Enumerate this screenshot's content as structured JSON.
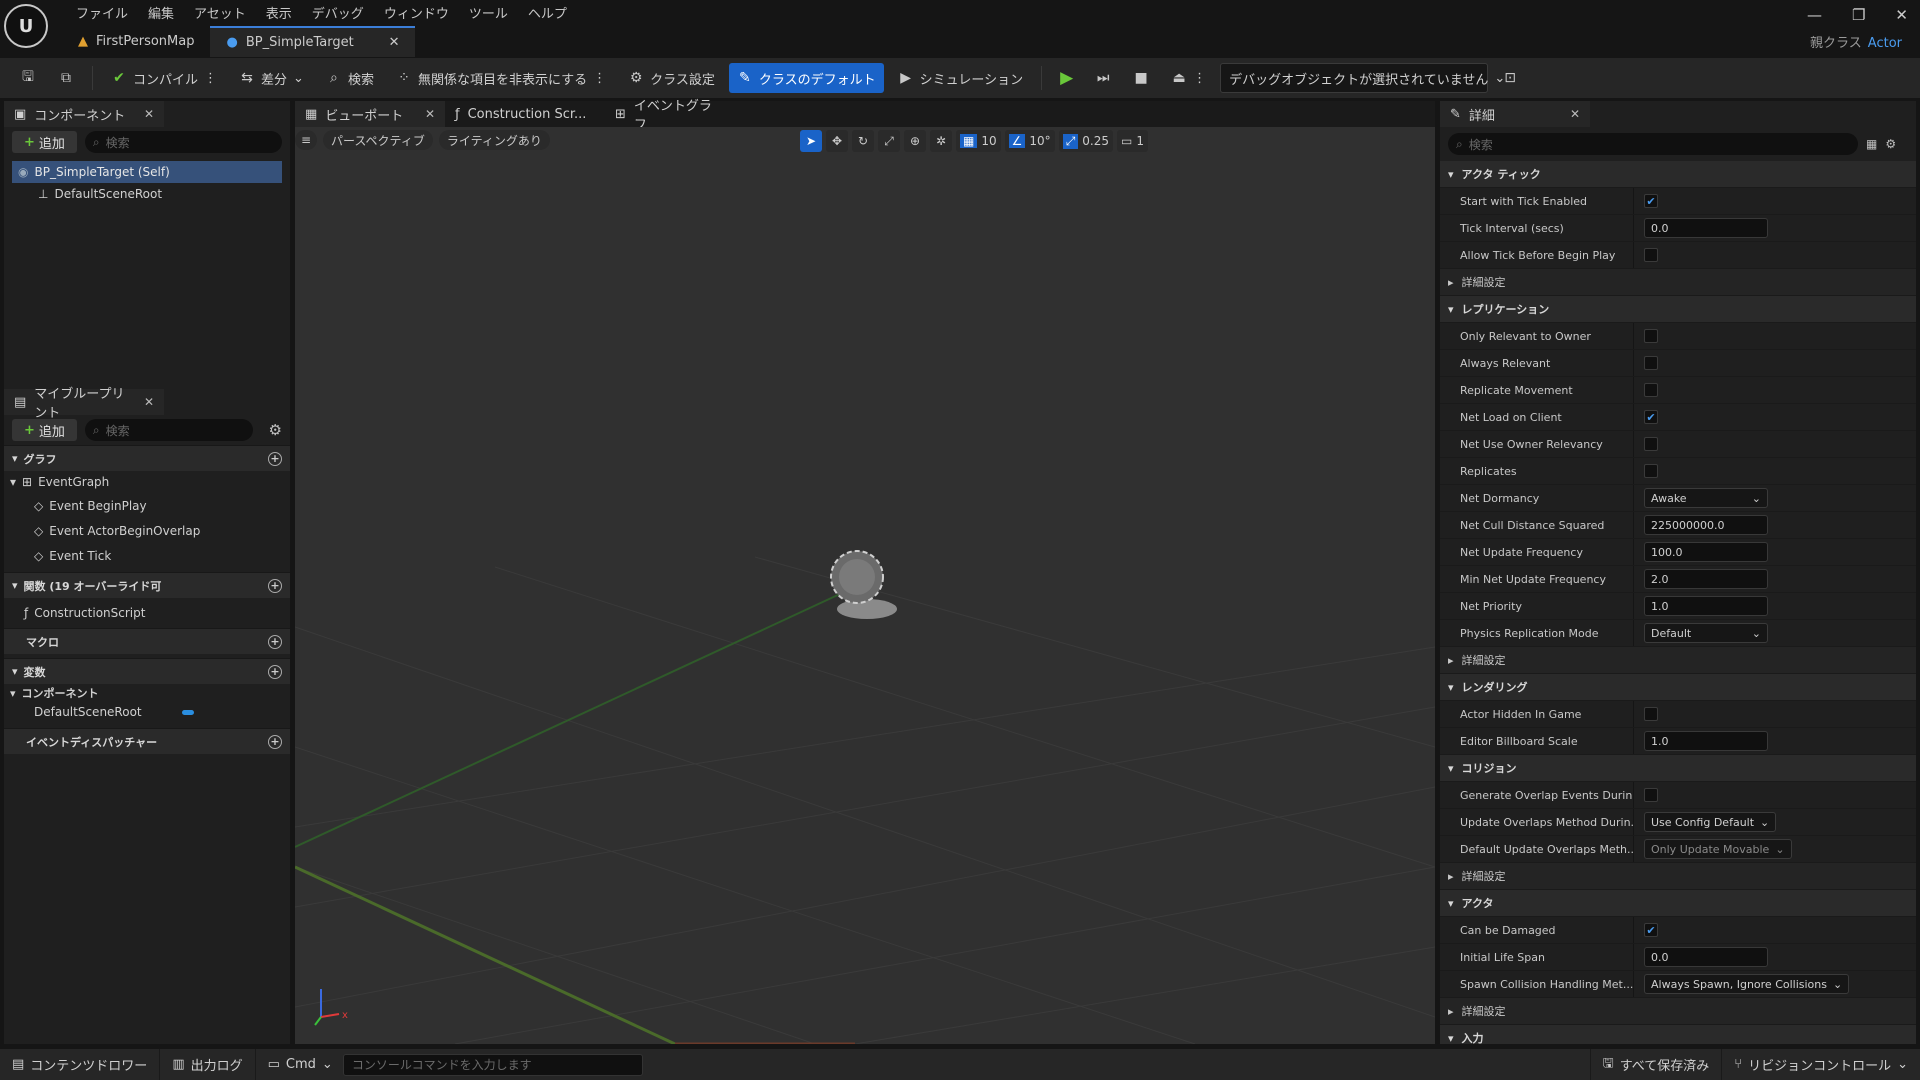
{
  "app": {
    "logo": "U",
    "parent_class_label": "親クラス",
    "parent_class_value": "Actor"
  },
  "menu": [
    "ファイル",
    "編集",
    "アセット",
    "表示",
    "デバッグ",
    "ウィンドウ",
    "ツール",
    "ヘルプ"
  ],
  "window_controls": [
    "minimize-icon",
    "restore-icon",
    "close-icon"
  ],
  "doc_tabs": [
    {
      "label": "FirstPersonMap"
    },
    {
      "label": "BP_SimpleTarget"
    }
  ],
  "toolbar": {
    "compile": "コンパイル",
    "diff": "差分",
    "search": "検索",
    "hide_unrelated": "無関係な項目を非表示にする",
    "class_settings": "クラス設定",
    "class_defaults": "クラスのデフォルト",
    "simulation": "シミュレーション",
    "debug_object": "デバッグオブジェクトが選択されていません"
  },
  "components": {
    "tab": "コンポーネント",
    "add": "追加",
    "search_placeholder": "検索",
    "root": "BP_SimpleTarget (Self)",
    "child": "DefaultSceneRoot"
  },
  "my_blueprint": {
    "tab": "マイブループリント",
    "add": "追加",
    "search_placeholder": "検索",
    "sections": {
      "graph": "グラフ",
      "functions": "関数 (19 オーバーライド可",
      "macros": "マクロ",
      "variables": "変数",
      "components": "コンポーネント",
      "dispatchers": "イベントディスパッチャー"
    },
    "event_graph": "EventGraph",
    "events": [
      "Event BeginPlay",
      "Event ActorBeginOverlap",
      "Event Tick"
    ],
    "construction_script": "ConstructionScript",
    "component_var": "DefaultSceneRoot"
  },
  "viewport": {
    "tabs": [
      "ビューポート",
      "Construction Scr...",
      "イベントグラフ"
    ],
    "perspective": "パースペクティブ",
    "lighting": "ライティングあり",
    "grid_snap": "10",
    "rot_snap": "10°",
    "scale_snap": "0.25",
    "camera_speed": "1"
  },
  "details": {
    "tab": "詳細",
    "search_placeholder": "検索",
    "advanced": "詳細設定",
    "sections": [
      {
        "title": "アクタ ティック",
        "rows": [
          {
            "label": "Start with Tick Enabled",
            "type": "check",
            "value": true
          },
          {
            "label": "Tick Interval (secs)",
            "type": "input",
            "value": "0.0"
          },
          {
            "label": "Allow Tick Before Begin Play",
            "type": "check",
            "value": false
          }
        ],
        "advanced": true
      },
      {
        "title": "レプリケーション",
        "rows": [
          {
            "label": "Only Relevant to Owner",
            "type": "check",
            "value": false
          },
          {
            "label": "Always Relevant",
            "type": "check",
            "value": false
          },
          {
            "label": "Replicate Movement",
            "type": "check",
            "value": false
          },
          {
            "label": "Net Load on Client",
            "type": "check",
            "value": true
          },
          {
            "label": "Net Use Owner Relevancy",
            "type": "check",
            "value": false
          },
          {
            "label": "Replicates",
            "type": "check",
            "value": false
          },
          {
            "label": "Net Dormancy",
            "type": "dropdown",
            "value": "Awake"
          },
          {
            "label": "Net Cull Distance Squared",
            "type": "input",
            "value": "225000000.0"
          },
          {
            "label": "Net Update Frequency",
            "type": "input",
            "value": "100.0"
          },
          {
            "label": "Min Net Update Frequency",
            "type": "input",
            "value": "2.0"
          },
          {
            "label": "Net Priority",
            "type": "input",
            "value": "1.0"
          },
          {
            "label": "Physics Replication Mode",
            "type": "dropdown",
            "value": "Default"
          }
        ],
        "advanced": true
      },
      {
        "title": "レンダリング",
        "rows": [
          {
            "label": "Actor Hidden In Game",
            "type": "check",
            "value": false
          },
          {
            "label": "Editor Billboard Scale",
            "type": "input",
            "value": "1.0"
          }
        ],
        "advanced": false
      },
      {
        "title": "コリジョン",
        "rows": [
          {
            "label": "Generate Overlap Events Durin...",
            "type": "check",
            "value": false
          },
          {
            "label": "Update Overlaps Method Durin...",
            "type": "dropdown",
            "value": "Use Config Default"
          },
          {
            "label": "Default Update Overlaps Meth...",
            "type": "dropdown_disabled",
            "value": "Only Update Movable"
          }
        ],
        "advanced": true
      },
      {
        "title": "アクタ",
        "rows": [
          {
            "label": "Can be Damaged",
            "type": "check",
            "value": true
          },
          {
            "label": "Initial Life Span",
            "type": "input",
            "value": "0.0"
          },
          {
            "label": "Spawn Collision Handling Met...",
            "type": "dropdown",
            "value": "Always Spawn, Ignore Collisions"
          }
        ],
        "advanced": true
      },
      {
        "title": "入力",
        "rows": [],
        "advanced": false
      }
    ]
  },
  "statusbar": {
    "content_drawer": "コンテンツドロワー",
    "output_log": "出力ログ",
    "cmd": "Cmd",
    "console_placeholder": "コンソールコマンドを入力します",
    "save_all": "すべて保存済み",
    "revision_control": "リビジョンコントロール"
  },
  "colors": {
    "accent": "#1a63c8",
    "selection": "#36517a",
    "play": "#6ac83a"
  }
}
